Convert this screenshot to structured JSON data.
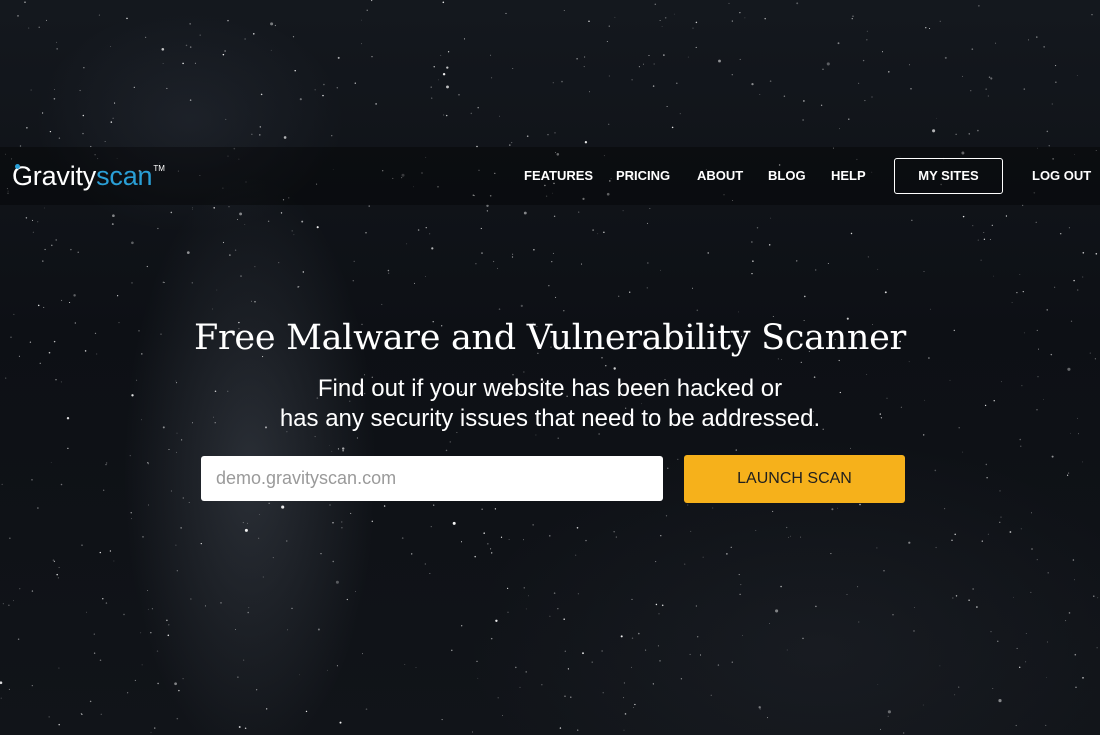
{
  "logo": {
    "word_primary": "Gravity",
    "word_accent": "scan",
    "trademark": "TM",
    "accent_color": "#2a9fd6"
  },
  "nav": {
    "items": [
      {
        "label": "FEATURES"
      },
      {
        "label": "PRICING"
      },
      {
        "label": "ABOUT"
      },
      {
        "label": "BLOG"
      },
      {
        "label": "HELP"
      }
    ],
    "my_sites_label": "MY SITES",
    "logout_label": "LOG OUT"
  },
  "hero": {
    "title": "Free Malware and Vulnerability Scanner",
    "subtitle_line1": "Find out if your website has been hacked or",
    "subtitle_line2": "has any security issues that need to be addressed."
  },
  "scan": {
    "input_value": "",
    "input_placeholder": "demo.gravityscan.com",
    "button_label": "LAUNCH SCAN",
    "button_color": "#f6b11b"
  }
}
